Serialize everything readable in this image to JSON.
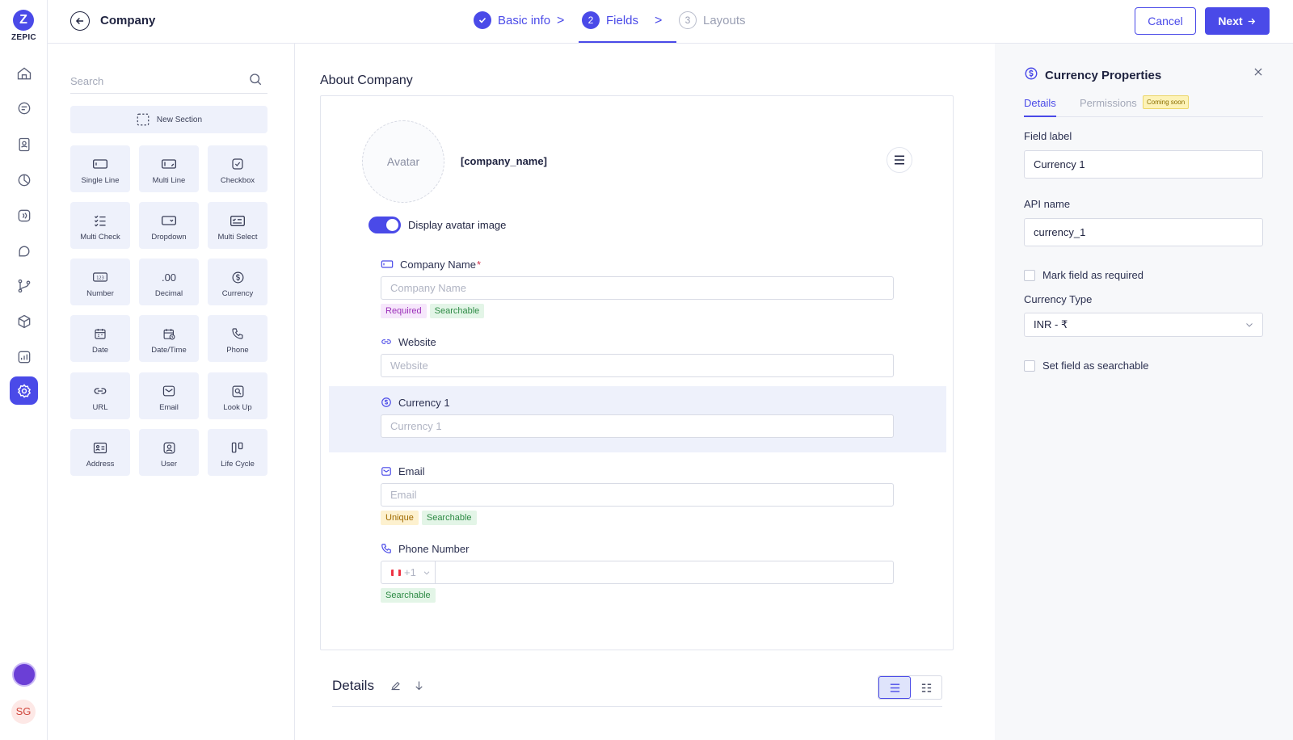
{
  "brand": {
    "name": "ZEPIC",
    "initial": "Z",
    "accent": "#4a4ae8"
  },
  "user": {
    "initials": "SG"
  },
  "header": {
    "title": "Company",
    "steps": [
      {
        "num": "1",
        "label": "Basic info",
        "state": "done"
      },
      {
        "num": "2",
        "label": "Fields",
        "state": "current"
      },
      {
        "num": "3",
        "label": "Layouts",
        "state": "todo"
      }
    ],
    "cancel_label": "Cancel",
    "next_label": "Next"
  },
  "palette": {
    "search_placeholder": "Search",
    "new_section": "New Section",
    "tiles": [
      {
        "label": "Single Line",
        "icon": "single-line-icon"
      },
      {
        "label": "Multi Line",
        "icon": "multi-line-icon"
      },
      {
        "label": "Checkbox",
        "icon": "checkbox-icon"
      },
      {
        "label": "Multi Check",
        "icon": "multi-check-icon"
      },
      {
        "label": "Dropdown",
        "icon": "dropdown-icon"
      },
      {
        "label": "Multi Select",
        "icon": "multi-select-icon"
      },
      {
        "label": "Number",
        "icon": "number-icon"
      },
      {
        "label": "Decimal",
        "icon": "decimal-icon",
        "glyph": ".00"
      },
      {
        "label": "Currency",
        "icon": "currency-icon"
      },
      {
        "label": "Date",
        "icon": "date-icon"
      },
      {
        "label": "Date/Time",
        "icon": "datetime-icon"
      },
      {
        "label": "Phone",
        "icon": "phone-icon"
      },
      {
        "label": "URL",
        "icon": "link-icon"
      },
      {
        "label": "Email",
        "icon": "email-icon"
      },
      {
        "label": "Look Up",
        "icon": "lookup-icon"
      },
      {
        "label": "Address",
        "icon": "address-icon"
      },
      {
        "label": "User",
        "icon": "user-icon"
      },
      {
        "label": "Life Cycle",
        "icon": "life-cycle-icon"
      }
    ]
  },
  "canvas": {
    "section_title": "About Company",
    "avatar_text": "Avatar",
    "company_token": "[company_name]",
    "toggle_label": "Display avatar image",
    "fields": {
      "company_name": {
        "label": "Company Name",
        "required_mark": "*",
        "placeholder": "Company Name",
        "tags": [
          "Required",
          "Searchable"
        ]
      },
      "website": {
        "label": "Website",
        "placeholder": "Website"
      },
      "currency": {
        "label": "Currency 1",
        "placeholder": "Currency 1"
      },
      "email": {
        "label": "Email",
        "placeholder": "Email",
        "tags": [
          "Unique",
          "Searchable"
        ]
      },
      "phone": {
        "label": "Phone Number",
        "country_code": "+1",
        "tags": [
          "Searchable"
        ]
      }
    },
    "details_title": "Details"
  },
  "properties": {
    "title": "Currency Properties",
    "tabs": {
      "details": "Details",
      "permissions": "Permissions",
      "coming_soon": "Coming soon"
    },
    "field_label_label": "Field label",
    "field_label_value": "Currency 1",
    "api_name_label": "API name",
    "api_name_value": "currency_1",
    "required_check": "Mark field as required",
    "currency_type_label": "Currency Type",
    "currency_type_value": "INR - ₹",
    "searchable_check": "Set field as searchable"
  }
}
